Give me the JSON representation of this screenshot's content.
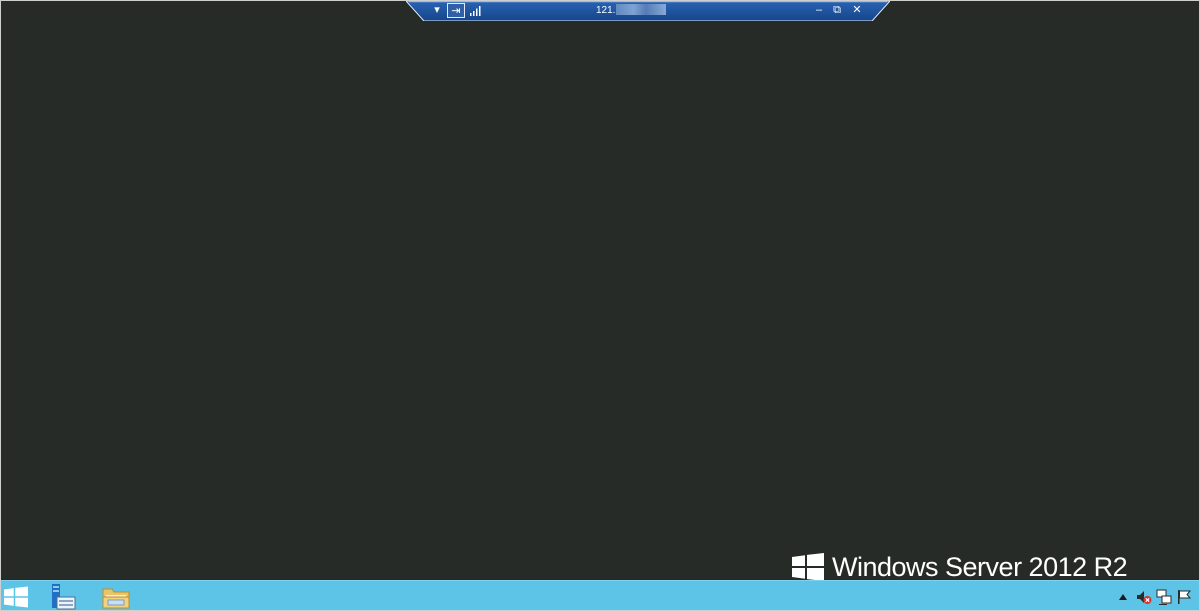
{
  "remote_bar": {
    "menu_glyph": "▾",
    "pin_glyph": "⇥",
    "connection_title": "121.",
    "minimize_glyph": "–",
    "restore_glyph": "⧉",
    "close_glyph": "✕",
    "bar_color": "#1c4f9a",
    "border_color": "#dfe9f7"
  },
  "watermark": {
    "text": "Windows Server 2012 R2"
  },
  "taskbar": {
    "color": "#5ec4e7",
    "items": [
      {
        "name": "start",
        "icon": "windows-logo-icon"
      },
      {
        "name": "server-manager",
        "icon": "server-manager-icon"
      },
      {
        "name": "file-explorer",
        "icon": "folder-icon"
      }
    ],
    "tray": [
      {
        "name": "show-hidden",
        "icon": "chevron-up-icon"
      },
      {
        "name": "volume",
        "icon": "speaker-muted-icon"
      },
      {
        "name": "network",
        "icon": "network-icon"
      },
      {
        "name": "action-center",
        "icon": "flag-icon"
      }
    ]
  },
  "colors": {
    "desktop": "#272b27",
    "taskbar": "#5ec4e7"
  }
}
